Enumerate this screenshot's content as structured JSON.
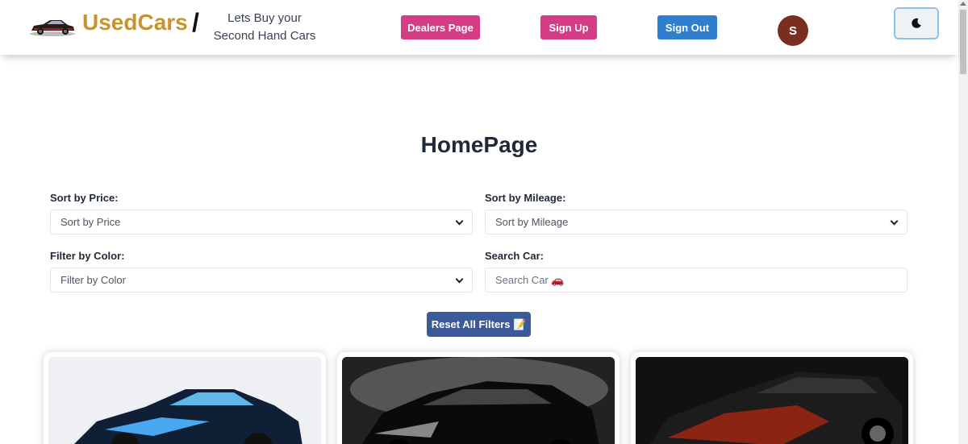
{
  "header": {
    "brand": "UsedCars",
    "slash": "/",
    "tagline_line1": "Lets Buy your",
    "tagline_line2": "Second Hand Cars",
    "dealers_label": "Dealers Page",
    "signup_label": "Sign Up",
    "signout_label": "Sign Out",
    "avatar_initial": "S"
  },
  "main": {
    "title": "HomePage",
    "sort_price_label": "Sort by Price:",
    "sort_price_value": "Sort by Price",
    "sort_mileage_label": "Sort by Mileage:",
    "sort_mileage_value": "Sort by Mileage",
    "filter_color_label": "Filter by Color:",
    "filter_color_value": "Filter by Color",
    "search_label": "Search Car:",
    "search_placeholder": "Search Car 🚗",
    "reset_label": "Reset All Filters 📝"
  },
  "colors": {
    "brand": "#c8922f",
    "pink": "#d63c86",
    "blue": "#2f7fd0",
    "reset": "#3a5a9b",
    "avatar": "#7b2e1f"
  },
  "icons": [
    "car-logo-icon",
    "moon-icon",
    "chevron-down-icon"
  ]
}
